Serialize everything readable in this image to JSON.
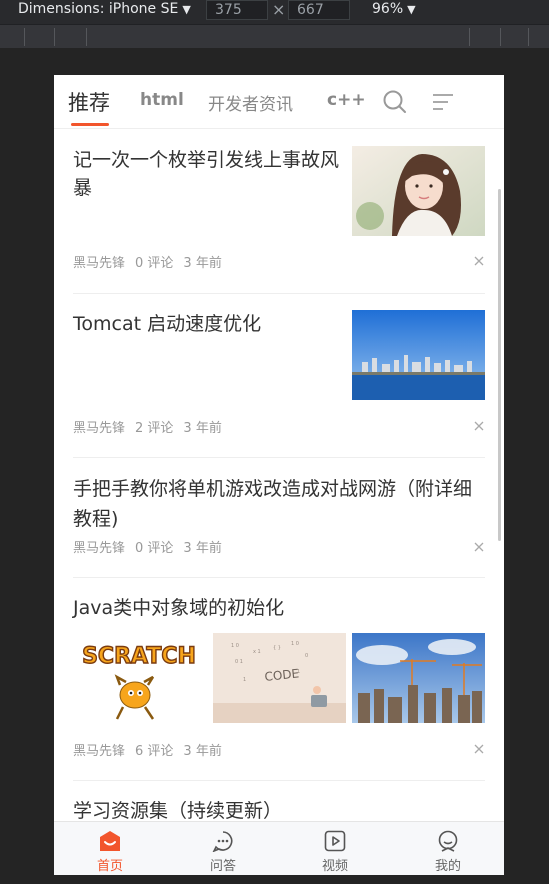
{
  "devtools": {
    "device": "Dimensions: iPhone SE",
    "width": "375",
    "height": "667",
    "zoom": "96%"
  },
  "nav": {
    "tabs": [
      "推荐",
      "html",
      "开发者资讯",
      "c++"
    ],
    "search_icon": "search-icon",
    "menu_icon": "menu-icon"
  },
  "articles": [
    {
      "title": "记一次一个枚举引发线上事故风暴",
      "author": "黑马先锋",
      "comments": "0 评论",
      "time": "3 年前",
      "images": 1
    },
    {
      "title": "Tomcat 启动速度优化",
      "author": "黑马先锋",
      "comments": "2 评论",
      "time": "3 年前",
      "images": 1
    },
    {
      "title": "手把手教你将单机游戏改造成对战网游（附详细教程)",
      "author": "黑马先锋",
      "comments": "0 评论",
      "time": "3 年前",
      "images": 0
    },
    {
      "title": "Java类中对象域的初始化",
      "author": "黑马先锋",
      "comments": "6 评论",
      "time": "3 年前",
      "images": 3
    },
    {
      "title": "学习资源集（持续更新）"
    }
  ],
  "tabbar": [
    {
      "label": "首页",
      "icon": "home-icon"
    },
    {
      "label": "问答",
      "icon": "chat-icon"
    },
    {
      "label": "视频",
      "icon": "video-icon"
    },
    {
      "label": "我的",
      "icon": "user-icon"
    }
  ],
  "colors": {
    "accent": "#f2552c"
  }
}
